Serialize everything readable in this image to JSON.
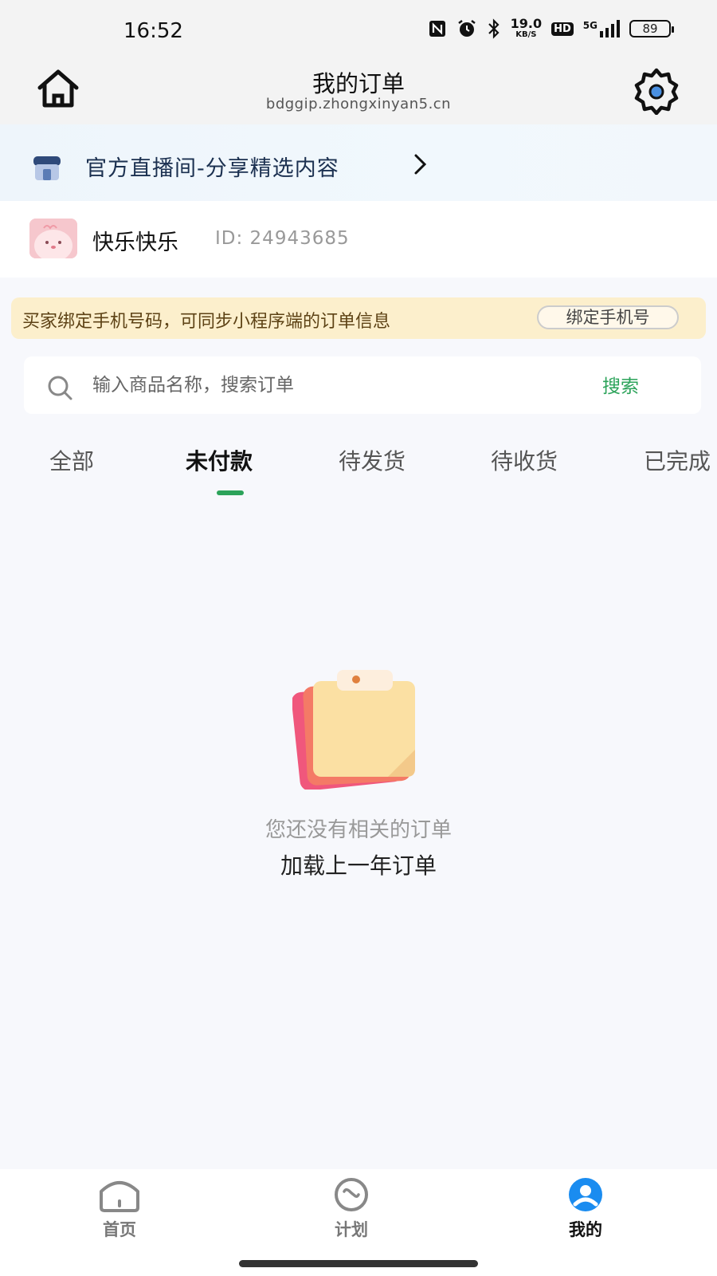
{
  "status_bar": {
    "time": "16:52",
    "net_speed_value": "19.0",
    "net_speed_unit": "KB/S",
    "hd_label": "HD",
    "network": "5G",
    "battery": "89"
  },
  "nav": {
    "title": "我的订单",
    "url": "bdggip.zhongxinyan5.cn",
    "home_icon": "home-icon",
    "settings_icon": "gear-icon"
  },
  "live_banner": {
    "text": "官方直播间-分享精选内容"
  },
  "user": {
    "name": "快乐快乐",
    "id": "ID: 24943685"
  },
  "bind_phone": {
    "message": "买家绑定手机号码，可同步小程序端的订单信息",
    "button": "绑定手机号"
  },
  "search": {
    "placeholder": "输入商品名称，搜索订单",
    "button": "搜索"
  },
  "tabs": [
    {
      "label": "全部",
      "active": false
    },
    {
      "label": "未付款",
      "active": true
    },
    {
      "label": "待发货",
      "active": false
    },
    {
      "label": "待收货",
      "active": false
    },
    {
      "label": "已完成",
      "active": false
    }
  ],
  "empty_state": {
    "message": "您还没有相关的订单",
    "load_more": "加载上一年订单"
  },
  "tabbar": [
    {
      "label": "首页",
      "icon": "home-icon",
      "active": false
    },
    {
      "label": "计划",
      "icon": "plan-icon",
      "active": false
    },
    {
      "label": "我的",
      "icon": "user-icon",
      "active": true
    }
  ],
  "colors": {
    "accent_green": "#2ca35a",
    "active_blue": "#1a8cf0",
    "banner_text": "#1b3050",
    "bind_bar_bg": "#fcefcc"
  }
}
